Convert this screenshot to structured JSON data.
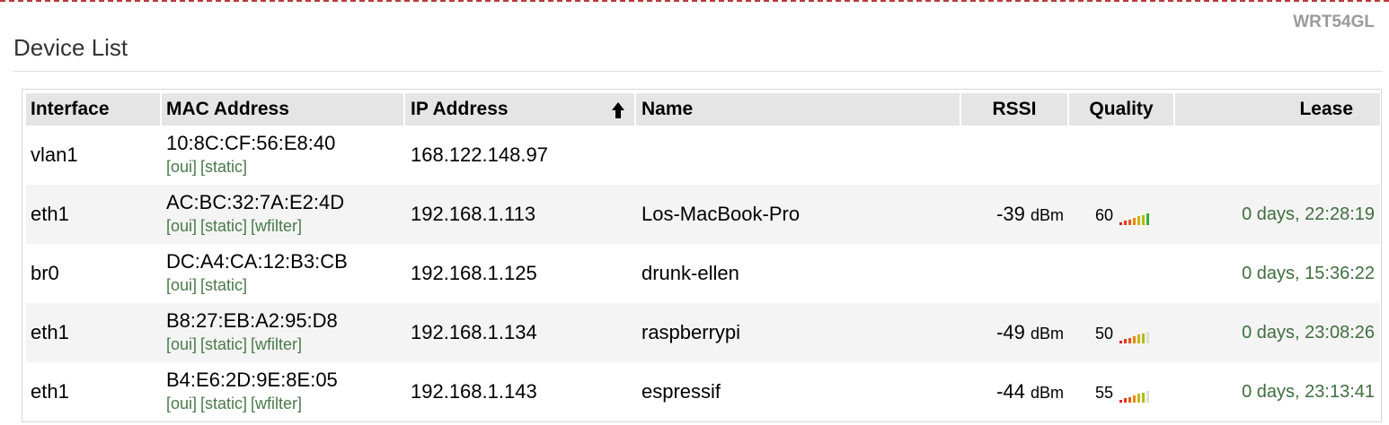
{
  "router_name": "WRT54GL",
  "page_title": "Device List",
  "table": {
    "headers": {
      "interface": "Interface",
      "mac": "MAC Address",
      "ip": "IP Address",
      "name": "Name",
      "rssi": "RSSI",
      "quality": "Quality",
      "lease": "Lease"
    },
    "sorted_by": "IP Address",
    "sort_direction": "ascending",
    "rows": [
      {
        "interface": "vlan1",
        "mac": "10:8C:CF:56:E8:40",
        "links": [
          "[oui]",
          "[static]"
        ],
        "ip": "168.122.148.97",
        "name": "",
        "rssi": "",
        "rssi_unit": "",
        "quality": "",
        "quality_bars": 0,
        "lease": ""
      },
      {
        "interface": "eth1",
        "mac": "AC:BC:32:7A:E2:4D",
        "links": [
          "[oui]",
          "[static]",
          "[wfilter]"
        ],
        "ip": "192.168.1.113",
        "name": "Los-MacBook-Pro",
        "rssi": "-39",
        "rssi_unit": "dBm",
        "quality": "60",
        "quality_bars": 7,
        "lease": "0 days, 22:28:19"
      },
      {
        "interface": "br0",
        "mac": "DC:A4:CA:12:B3:CB",
        "links": [
          "[oui]",
          "[static]"
        ],
        "ip": "192.168.1.125",
        "name": "drunk-ellen",
        "rssi": "",
        "rssi_unit": "",
        "quality": "",
        "quality_bars": 0,
        "lease": "0 days, 15:36:22"
      },
      {
        "interface": "eth1",
        "mac": "B8:27:EB:A2:95:D8",
        "links": [
          "[oui]",
          "[static]",
          "[wfilter]"
        ],
        "ip": "192.168.1.134",
        "name": "raspberrypi",
        "rssi": "-49",
        "rssi_unit": "dBm",
        "quality": "50",
        "quality_bars": 6,
        "lease": "0 days, 23:08:26"
      },
      {
        "interface": "eth1",
        "mac": "B4:E6:2D:9E:8E:05",
        "links": [
          "[oui]",
          "[static]",
          "[wfilter]"
        ],
        "ip": "192.168.1.143",
        "name": "espressif",
        "rssi": "-44",
        "rssi_unit": "dBm",
        "quality": "55",
        "quality_bars": 6,
        "lease": "0 days, 23:13:41"
      }
    ]
  },
  "colors": {
    "quality_bar_scale": [
      "#e02020",
      "#e23a1a",
      "#e55a15",
      "#e88a10",
      "#d4b010",
      "#a8c010",
      "#30b030"
    ],
    "quality_bar_empty": "#dddddd",
    "link_green": "#4a7a4a",
    "lease_green": "#3f6e3f",
    "header_bg": "#e5e5e5",
    "row_alt_bg": "#f4f4f4",
    "top_border_red": "#b83a3a"
  },
  "icons": {
    "sort": "arrow-up-icon"
  }
}
